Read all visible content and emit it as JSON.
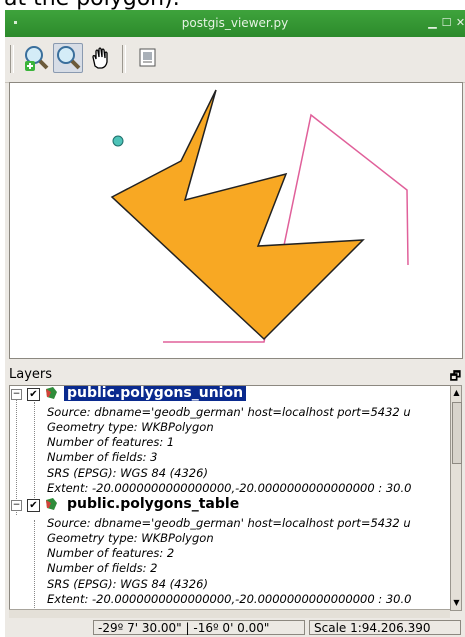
{
  "caption": {
    "text": "at the polygon)."
  },
  "window": {
    "title": "postgis_viewer.py",
    "colors": {
      "title_bar": "#2f912d",
      "polygon_fill": "#f8a823",
      "polygon_stroke": "#222222",
      "line": "#e0609a",
      "point": "#4ec3b8",
      "selection": "#0a2a8e"
    }
  },
  "toolbar": {
    "buttons": [
      {
        "icon": "zoom-in-icon",
        "active": false
      },
      {
        "icon": "zoom-out-icon",
        "active": true
      },
      {
        "icon": "pan-hand-icon",
        "active": false
      },
      {
        "icon": "zoom-full-icon",
        "active": false
      }
    ]
  },
  "layers_panel": {
    "title": "Layers",
    "float_icon": "float-icon",
    "close_icon": "close-icon",
    "layers": [
      {
        "name": "public.polygons_union",
        "checked": true,
        "selected": true,
        "expander": "−",
        "properties": [
          "Source: dbname='geodb_german' host=localhost port=5432 u",
          "Geometry type: WKBPolygon",
          "Number of features: 1",
          "Number of fields: 3",
          "SRS (EPSG): WGS 84 (4326)",
          "Extent: -20.0000000000000000,-20.0000000000000000 : 30.0"
        ]
      },
      {
        "name": "public.polygons_table",
        "checked": true,
        "selected": false,
        "expander": "−",
        "properties": [
          "Source: dbname='geodb_german' host=localhost port=5432 u",
          "Geometry type: WKBPolygon",
          "Number of features: 2",
          "Number of fields: 2",
          "SRS (EPSG): WGS 84 (4326)",
          "Extent: -20.0000000000000000,-20.0000000000000000 : 30.0"
        ]
      }
    ]
  },
  "statusbar": {
    "coordinates": "-29º 7' 30.00\" | -16º 0' 0.00\"",
    "scale": "Scale 1:94.206.390"
  }
}
